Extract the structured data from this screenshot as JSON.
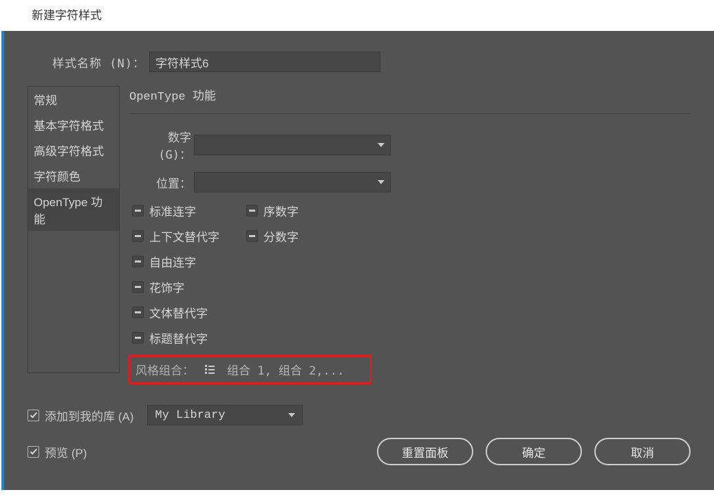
{
  "dialog": {
    "title": "新建字符样式"
  },
  "form": {
    "styleNameLabel": "样式名称 (N)：",
    "styleNameValue": "字符样式6"
  },
  "sidebar": {
    "items": [
      {
        "label": "常规"
      },
      {
        "label": "基本字符格式"
      },
      {
        "label": "高级字符格式"
      },
      {
        "label": "字符颜色"
      },
      {
        "label": "OpenType 功能"
      }
    ]
  },
  "panel": {
    "title": "OpenType 功能",
    "numbersLabel": "数字 (G)：",
    "numbersValue": "",
    "positionLabel": "位置：",
    "positionValue": "",
    "checks": {
      "standardLigatures": "标准连字",
      "ordinals": "序数字",
      "contextualAlts": "上下文替代字",
      "fractions": "分数字",
      "discretionaryLigatures": "自由连字",
      "swashes": "花饰字",
      "stylisticAlts": "文体替代字",
      "titlingAlts": "标题替代字"
    },
    "stylisticSets": {
      "label": "风格组合：",
      "value": "组合 1, 组合 2,..."
    }
  },
  "bottom": {
    "addToLibraryLabel": "添加到我的库 (A)",
    "librarySelected": "My Library",
    "previewLabel": "预览 (P)"
  },
  "buttons": {
    "resetPanel": "重置面板",
    "ok": "确定",
    "cancel": "取消"
  }
}
